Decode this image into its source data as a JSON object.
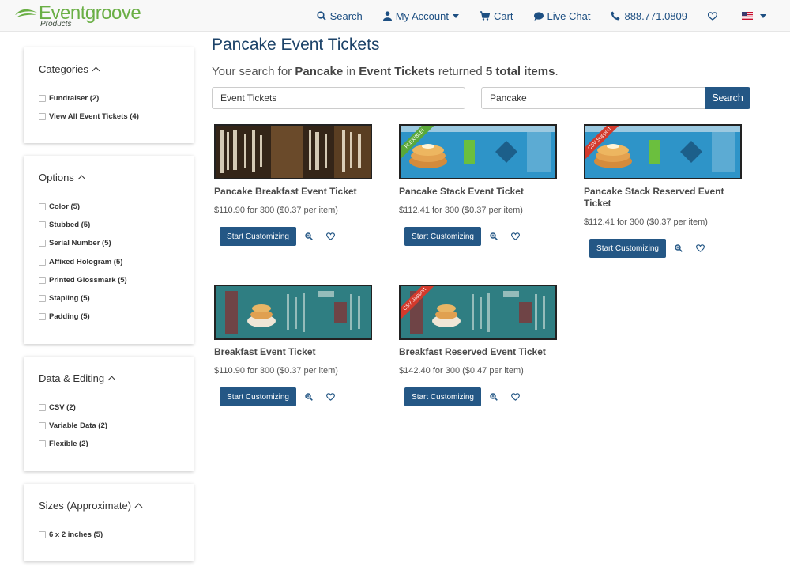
{
  "header": {
    "brand_name": "Eventgroove",
    "brand_sub": "Products",
    "nav": [
      {
        "label": "Search",
        "icon": "search-icon"
      },
      {
        "label": "My Account",
        "icon": "user-icon"
      },
      {
        "label": "Cart",
        "icon": "cart-icon"
      },
      {
        "label": "Live Chat",
        "icon": "chat-icon"
      },
      {
        "label": "888.771.0809",
        "icon": "phone-icon"
      }
    ]
  },
  "colors": {
    "brand_green": "#6aaf45",
    "primary_blue": "#245785",
    "title_blue": "#1d4369"
  },
  "sidebar": {
    "categories": {
      "title": "Categories",
      "items": [
        "Fundraiser (2)",
        "View All Event Tickets (4)"
      ]
    },
    "options": {
      "title": "Options",
      "items": [
        "Color (5)",
        "Stubbed (5)",
        "Serial Number (5)",
        "Affixed Hologram (5)",
        "Printed Glossmark (5)",
        "Stapling (5)",
        "Padding (5)"
      ]
    },
    "data_editing": {
      "title": "Data & Editing",
      "items": [
        "CSV (2)",
        "Variable Data (2)",
        "Flexible (2)"
      ]
    },
    "sizes": {
      "title": "Sizes (Approximate)",
      "items": [
        "6 x 2 inches (5)"
      ]
    }
  },
  "main": {
    "title": "Pancake Event Tickets",
    "summary": {
      "prefix": "Your search for ",
      "term": "Pancake",
      "mid": " in ",
      "category": "Event Tickets",
      "suffix": " returned ",
      "count": "5 total items",
      "end": "."
    },
    "category_field": "Event Tickets",
    "search_field": "Pancake",
    "search_button": "Search"
  },
  "products": [
    {
      "name": "Pancake Breakfast Event Ticket",
      "price": "$110.90 for 300 ($0.37 per item)",
      "cta": "Start Customizing",
      "badge": ""
    },
    {
      "name": "Pancake Stack Event Ticket",
      "price": "$112.41 for 300 ($0.37 per item)",
      "cta": "Start Customizing",
      "badge": "FLEXIBLE!"
    },
    {
      "name": "Pancake Stack Reserved Event Ticket",
      "price": "$112.41 for 300 ($0.37 per item)",
      "cta": "Start Customizing",
      "badge": "CSV Support"
    },
    {
      "name": "Breakfast Event Ticket",
      "price": "$110.90 for 300 ($0.37 per item)",
      "cta": "Start Customizing",
      "badge": ""
    },
    {
      "name": "Breakfast Reserved Event Ticket",
      "price": "$142.40 for 300 ($0.47 per item)",
      "cta": "Start Customizing",
      "badge": "CSV Support"
    }
  ]
}
